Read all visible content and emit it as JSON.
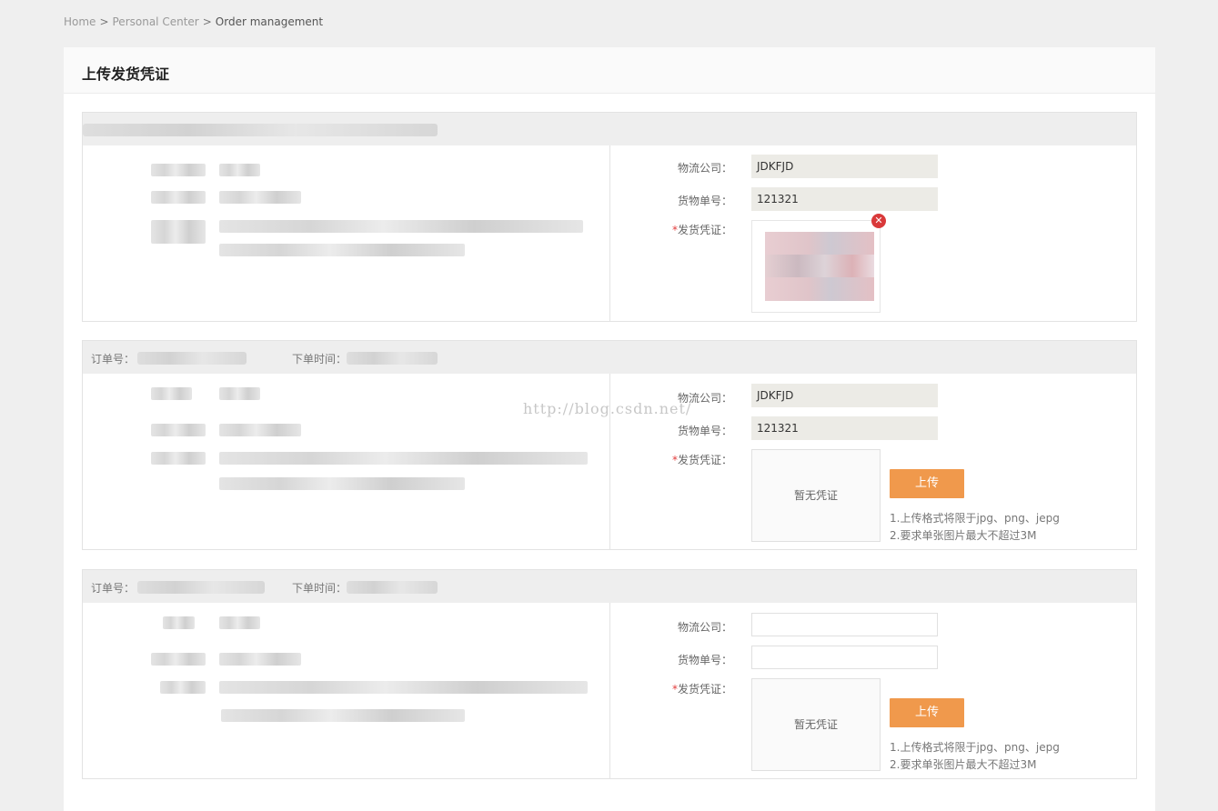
{
  "breadcrumb": {
    "home": "Home",
    "sep": ">",
    "personal": "Personal Center",
    "current": "Order management"
  },
  "page": {
    "title": "上传发货凭证"
  },
  "watermark": "http://blog.csdn.net/",
  "labels": {
    "order_no": "订单号：",
    "order_time": "下单时间：",
    "logistics": "物流公司：",
    "tracking": "货物单号：",
    "required_mark": "*",
    "proof": "发货凭证：",
    "no_proof": "暂无凭证",
    "upload": "上传",
    "hint1": "1.上传格式将限于jpg、png、jepg",
    "hint2": "2.要求单张图片最大不超过3M"
  },
  "orders": [
    {
      "logistics": "JDKFJD",
      "tracking": "121321",
      "has_proof": true
    },
    {
      "logistics": "JDKFJD",
      "tracking": "121321",
      "has_proof": false
    },
    {
      "logistics": "",
      "tracking": "",
      "has_proof": false
    }
  ],
  "colors": {
    "accent": "#f0994c",
    "required": "#e23c3c",
    "remove": "#d9393a"
  }
}
